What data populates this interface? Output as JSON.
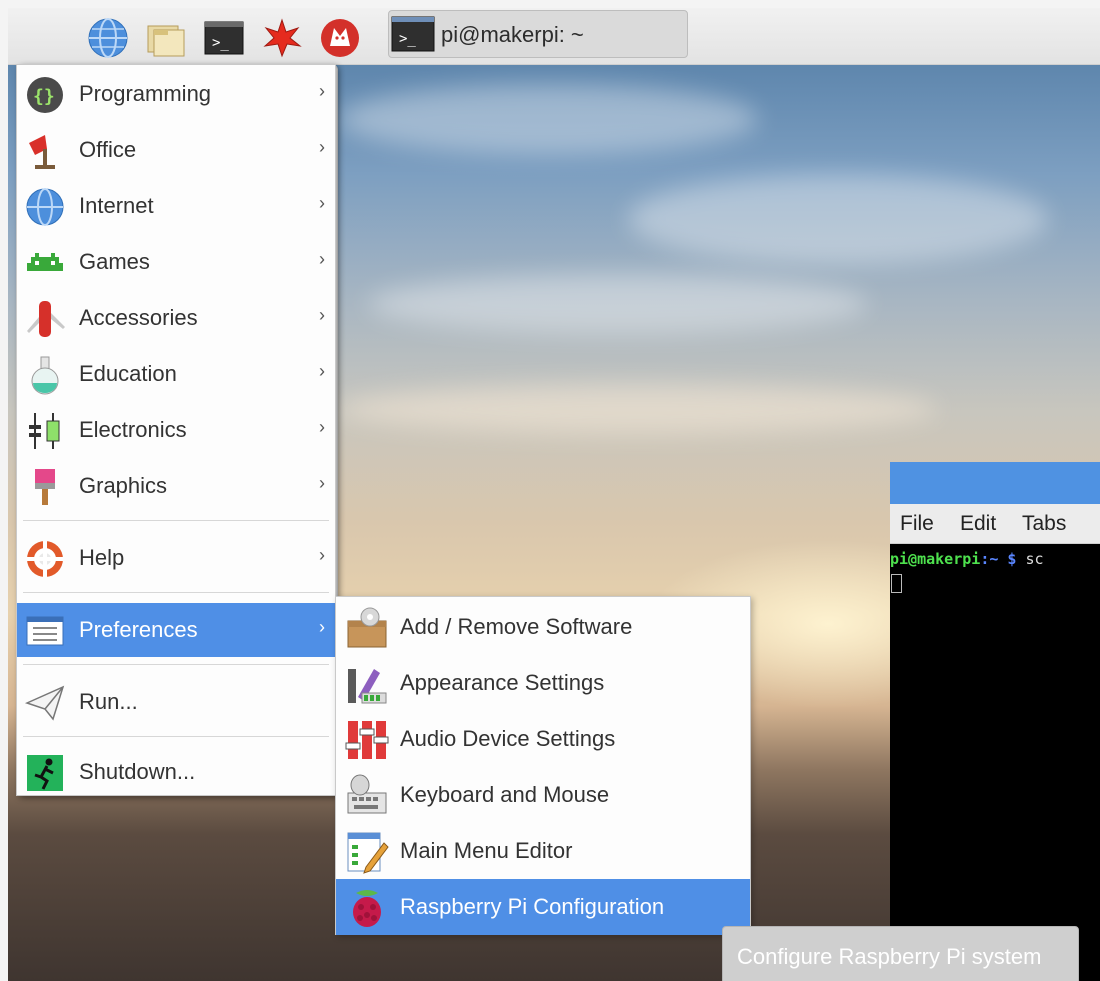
{
  "taskbar": {
    "icons": [
      "raspberry-menu-icon",
      "web-browser-icon",
      "file-manager-icon",
      "terminal-icon",
      "mathematica-icon",
      "wolfram-icon"
    ],
    "task_title": "pi@makerpi: ~"
  },
  "menu": {
    "items": [
      {
        "label": "Programming",
        "icon": "programming-icon",
        "arrow": "›"
      },
      {
        "label": "Office",
        "icon": "office-icon",
        "arrow": "›"
      },
      {
        "label": "Internet",
        "icon": "internet-icon",
        "arrow": "›"
      },
      {
        "label": "Games",
        "icon": "games-icon",
        "arrow": "›"
      },
      {
        "label": "Accessories",
        "icon": "accessories-icon",
        "arrow": "›"
      },
      {
        "label": "Education",
        "icon": "education-icon",
        "arrow": "›"
      },
      {
        "label": "Electronics",
        "icon": "electronics-icon",
        "arrow": "›"
      },
      {
        "label": "Graphics",
        "icon": "graphics-icon",
        "arrow": "›"
      },
      {
        "label": "Help",
        "icon": "help-icon",
        "arrow": "›"
      },
      {
        "label": "Preferences",
        "icon": "preferences-icon",
        "arrow": "›",
        "selected": true
      },
      {
        "label": "Run...",
        "icon": "run-icon"
      },
      {
        "label": "Shutdown...",
        "icon": "shutdown-icon"
      }
    ]
  },
  "submenu": {
    "items": [
      {
        "label": "Add / Remove Software",
        "icon": "package-icon"
      },
      {
        "label": "Appearance Settings",
        "icon": "appearance-icon"
      },
      {
        "label": "Audio Device Settings",
        "icon": "audio-mixer-icon"
      },
      {
        "label": "Keyboard and Mouse",
        "icon": "keyboard-mouse-icon"
      },
      {
        "label": "Main Menu Editor",
        "icon": "menu-editor-icon"
      },
      {
        "label": "Raspberry Pi Configuration",
        "icon": "raspberry-icon",
        "selected": true
      }
    ]
  },
  "tooltip": "Configure Raspberry Pi system",
  "terminal": {
    "menu": [
      "File",
      "Edit",
      "Tabs"
    ],
    "prompt_user": "pi@makerpi",
    "prompt_path": ":~",
    "prompt_symbol": "$",
    "prompt_command": "sc"
  },
  "colors": {
    "selection": "#4f8fe6",
    "terminal_title": "#4f92e2",
    "prompt_user": "#4ee14e",
    "prompt_path": "#5a86ff"
  }
}
